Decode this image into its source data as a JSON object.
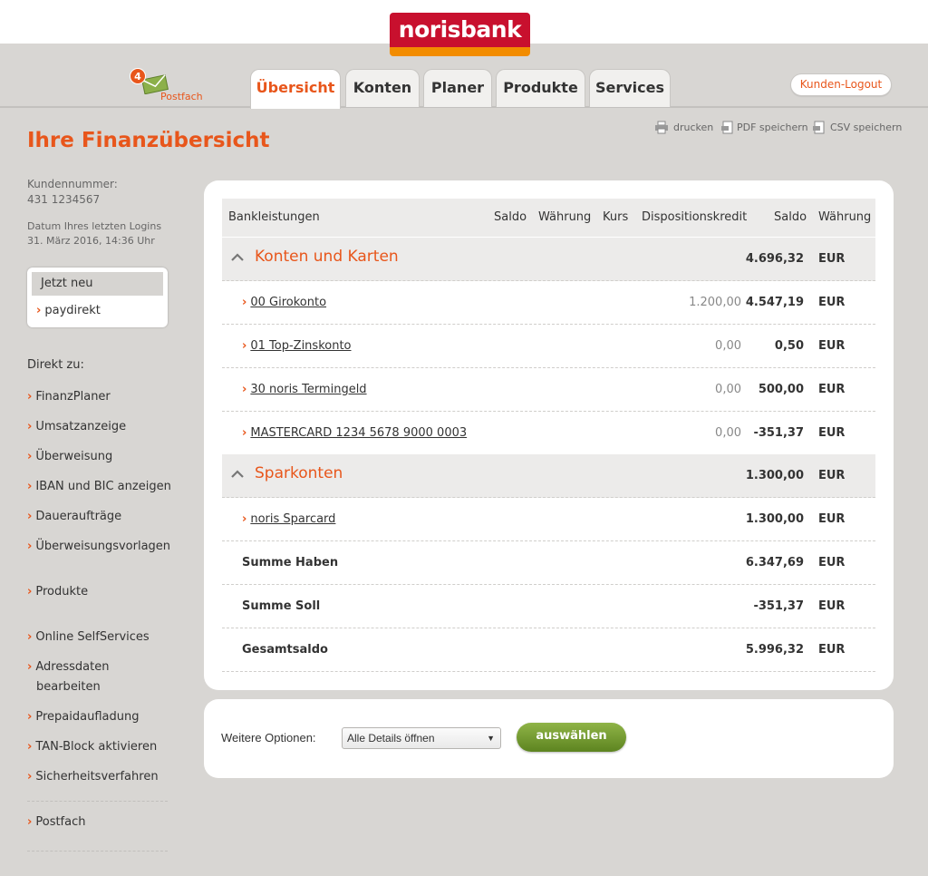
{
  "header": {
    "logo_text": "norisbank",
    "postfach": {
      "count": "4",
      "label": "Postfach"
    },
    "tabs": [
      {
        "label": "Übersicht",
        "active": true
      },
      {
        "label": "Konten"
      },
      {
        "label": "Planer"
      },
      {
        "label": "Produkte"
      },
      {
        "label": "Services"
      }
    ],
    "logout_label": "Kunden-Logout"
  },
  "actions": {
    "print": "drucken",
    "pdf": "PDF speichern",
    "csv": "CSV speichern"
  },
  "page_title": "Ihre Finanzübersicht",
  "sidebar": {
    "kundennummer_label": "Kundennummer:",
    "kundennummer": "431 1234567",
    "login_label": "Datum Ihres letzten Logins",
    "login_value": "31. März 2016, 14:36 Uhr",
    "jetzt_neu": "Jetzt neu",
    "jetzt_item": "paydirekt",
    "direkt_label": "Direkt zu:",
    "links": [
      "FinanzPlaner",
      "Umsatzanzeige",
      "Überweisung",
      "IBAN und BIC anzeigen",
      "Daueraufträge",
      "Überweisungsvorlagen",
      "Produkte",
      "Online SelfServices",
      "Adressdaten",
      "bearbeiten",
      "Prepaidaufladung",
      "TAN-Block aktivieren",
      "Sicherheitsverfahren",
      "Postfach"
    ]
  },
  "table": {
    "headers": [
      "Bankleistungen",
      "Saldo",
      "Währung",
      "Kurs",
      "Dispositionskredit",
      "Saldo",
      "Währung"
    ],
    "groups": [
      {
        "title": "Konten und Karten",
        "saldo": "4.696,32",
        "currency": "EUR"
      },
      {
        "title": "Sparkonten",
        "saldo": "1.300,00",
        "currency": "EUR"
      }
    ],
    "accounts": [
      {
        "name": "00 Girokonto",
        "dispo": "1.200,00",
        "saldo": "4.547,19",
        "currency": "EUR"
      },
      {
        "name": "01 Top-Zinskonto",
        "dispo": "0,00",
        "saldo": "0,50",
        "currency": "EUR"
      },
      {
        "name": "30 noris Termingeld",
        "dispo": "0,00",
        "saldo": "500,00",
        "currency": "EUR"
      },
      {
        "name": "MASTERCARD 1234 5678 9000 0003",
        "dispo": "0,00",
        "saldo": "-351,37",
        "currency": "EUR"
      },
      {
        "name": "noris Sparcard",
        "dispo": "",
        "saldo": "1.300,00",
        "currency": "EUR"
      }
    ],
    "totals": [
      {
        "label": "Summe Haben",
        "saldo": "6.347,69",
        "currency": "EUR"
      },
      {
        "label": "Summe Soll",
        "saldo": "-351,37",
        "currency": "EUR"
      },
      {
        "label": "Gesamtsaldo",
        "saldo": "5.996,32",
        "currency": "EUR"
      }
    ]
  },
  "options": {
    "label": "Weitere Optionen:",
    "selected": "Alle Details öffnen",
    "button": "auswählen"
  },
  "colors": {
    "accent_orange": "#e8561b",
    "brand_red": "#c8102e",
    "brand_orange": "#f28c00",
    "button_green": "#6e9530",
    "background": "#d8d6d3"
  }
}
